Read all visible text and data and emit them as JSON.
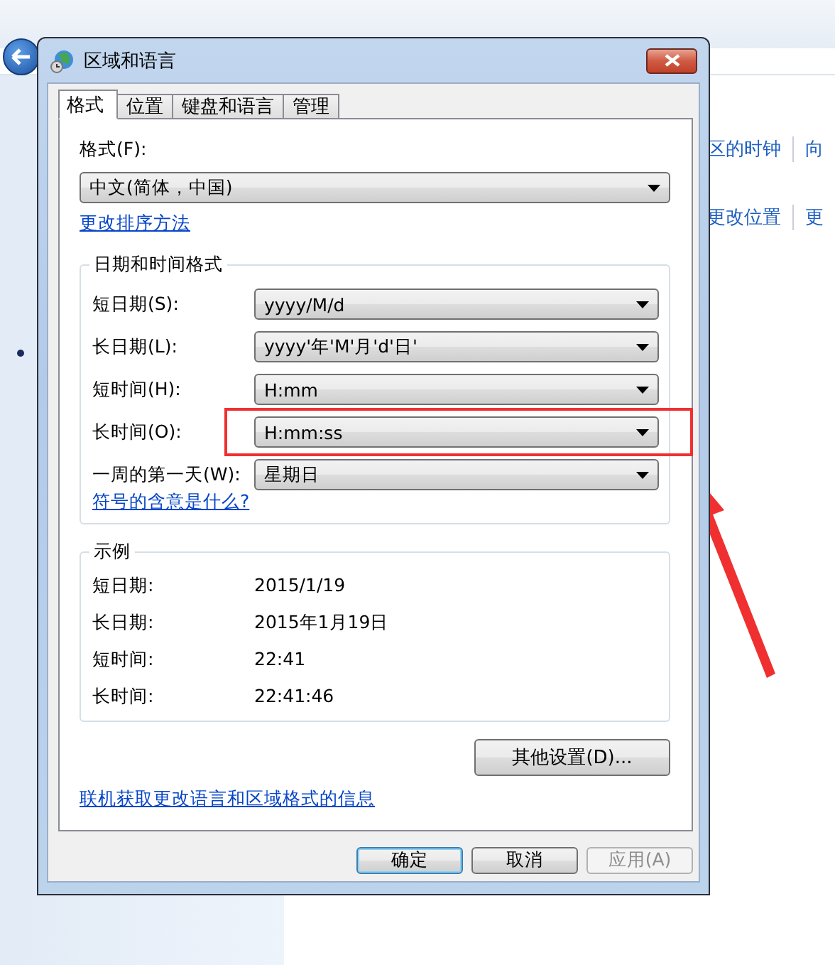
{
  "background": {
    "link_rows": [
      {
        "links": [
          "区的时钟",
          "向"
        ]
      },
      {
        "links": [
          "更改位置",
          "更"
        ]
      }
    ]
  },
  "window": {
    "title": "区域和语言"
  },
  "tabs": [
    {
      "label": "格式",
      "selected": true
    },
    {
      "label": "位置",
      "selected": false
    },
    {
      "label": "键盘和语言",
      "selected": false
    },
    {
      "label": "管理",
      "selected": false
    }
  ],
  "format": {
    "label": "格式(F):",
    "value": "中文(简体，中国)"
  },
  "sort_link": "更改排序方法",
  "date_time_formats": {
    "title": "日期和时间格式",
    "rows": [
      {
        "label": "短日期(S):",
        "value": "yyyy/M/d",
        "highlighted": false
      },
      {
        "label": "长日期(L):",
        "value": "yyyy'年'M'月'd'日'",
        "highlighted": false
      },
      {
        "label": "短时间(H):",
        "value": "H:mm",
        "highlighted": false
      },
      {
        "label": "长时间(O):",
        "value": "H:mm:ss",
        "highlighted": true
      },
      {
        "label": "一周的第一天(W):",
        "value": "星期日",
        "highlighted": false
      }
    ],
    "help_link": "符号的含意是什么?"
  },
  "examples": {
    "title": "示例",
    "rows": [
      {
        "label": "短日期:",
        "value": "2015/1/19"
      },
      {
        "label": "长日期:",
        "value": "2015年1月19日"
      },
      {
        "label": "短时间:",
        "value": "22:41"
      },
      {
        "label": "长时间:",
        "value": "22:41:46"
      }
    ]
  },
  "other_settings_button": "其他设置(D)...",
  "online_link": "联机获取更改语言和区域格式的信息",
  "buttons": [
    {
      "label": "确定",
      "kind": "default"
    },
    {
      "label": "取消",
      "kind": "normal"
    },
    {
      "label": "应用(A)",
      "kind": "disabled"
    }
  ]
}
